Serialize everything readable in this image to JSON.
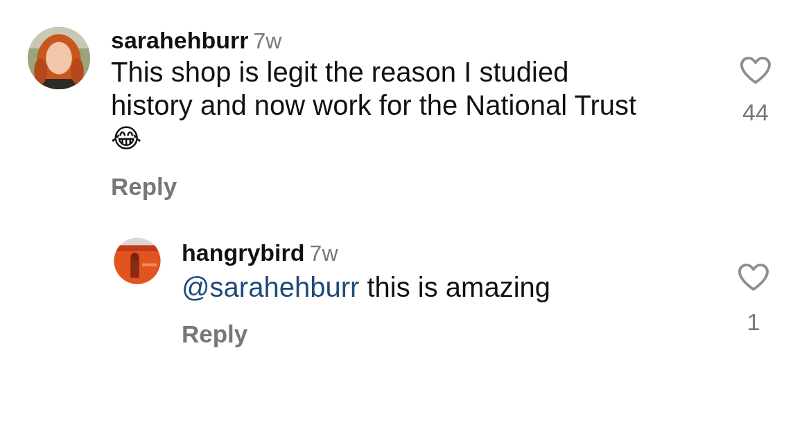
{
  "comments": [
    {
      "username": "sarahehburr",
      "age": "7w",
      "text": "This shop is legit the reason I studied history and now work for the National Trust",
      "emoji": "😂",
      "liked": false,
      "likes": "44",
      "reply": "Reply",
      "replies": [
        {
          "username": "hangrybird",
          "age": "7w",
          "mention": "@sarahehburr",
          "text": "this is amazing",
          "liked": false,
          "likes": "1",
          "reply": "Reply"
        }
      ]
    }
  ]
}
